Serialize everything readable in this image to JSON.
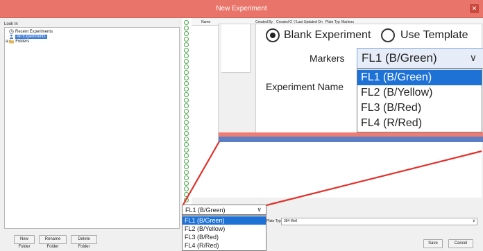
{
  "window": {
    "title": "New Experiment",
    "close_glyph": "✕"
  },
  "left_panel": {
    "look_in_label": "Look In",
    "tree": [
      {
        "label": "Recent Experiments",
        "icon": "clock-icon"
      },
      {
        "label": "All Experiments",
        "icon": "user-icon",
        "selected": true
      },
      {
        "label": "Folders",
        "icon": "folder-icon"
      }
    ],
    "buttons": [
      "New Folder",
      "Rename Folder",
      "Delete Folder"
    ]
  },
  "grid": {
    "columns": [
      "Name",
      "Created By",
      "Created O ▽",
      "Last Updated On",
      "Plate Typ",
      "Markers"
    ]
  },
  "zoom_panel": {
    "blank_label": "Blank Experiment",
    "template_label": "Use Template",
    "markers_label": "Markers",
    "experiment_name_label": "Experiment Name",
    "selected_marker": "FL1 (B/Green)",
    "marker_options": [
      "FL1 (B/Green)",
      "FL2 (B/Yellow)",
      "FL3 (B/Red)",
      "FL4 (R/Red)"
    ],
    "chevron": "∨"
  },
  "lower_form": {
    "plate_type_label": "Plate Type",
    "plate_type_value": "384 Well",
    "selected_marker": "FL1 (B/Green)",
    "marker_options": [
      "FL1 (B/Green)",
      "FL2 (B/Yellow)",
      "FL3 (B/Red)",
      "FL4 (R/Red)"
    ]
  },
  "footer": {
    "save_label": "Save",
    "cancel_label": "Cancel"
  },
  "colors": {
    "titlebar": "#e9756a",
    "selection": "#1e72d6",
    "status_green": "#47a447",
    "callout_red": "#e2312b"
  }
}
